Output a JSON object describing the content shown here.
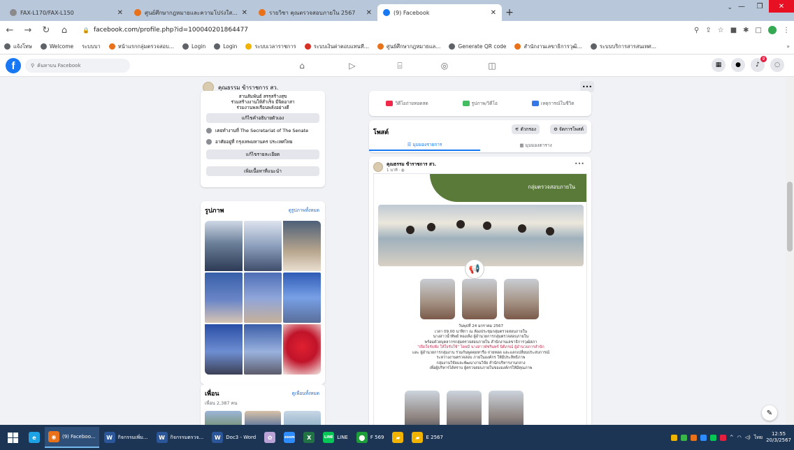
{
  "browser": {
    "tabs": [
      {
        "label": "FAX-L170/FAX-L150",
        "favicon": "gray"
      },
      {
        "label": "ศูนย์ศึกษากฎหมายและความโปร่งใส...",
        "favicon": "orange"
      },
      {
        "label": "รายวิชา คุณตรวจสอบภายใน 2567",
        "favicon": "orange"
      },
      {
        "label": "(9) Facebook",
        "favicon": "fb"
      }
    ],
    "new_tab": "+",
    "url": "facebook.com/profile.php?id=100040201864477",
    "bookmarks": [
      "แจ้งโทษ",
      "Welcome",
      "ระบบบา",
      "หน้าแรกกลุ่มตรวจสอบ...",
      "Login",
      "Login",
      "ระบบเวลาราชการ",
      "ระบบเงินค่าตอบแทนที...",
      "ศูนย์ศึกษากฎหมายแล...",
      "Generate QR code",
      "สำนักงานเลขาธิการวุฒิ...",
      "ระบบบริการสารสนเทศ..."
    ],
    "bookmarks_more": "»"
  },
  "fb": {
    "search_placeholder": "ค้นหาบน Facebook",
    "notification_count": "9"
  },
  "profile": {
    "name": "คุณธรรม ข้าราชการ สว.",
    "bio": [
      "สานสัมพันธ์ สรรสร้างสุข",
      "ร่วมสร้างงานให้สำเร็จ มีจิตอาสา",
      "ร่วมงานพลเรือนพลังอย่างดี"
    ],
    "edit_bio": "แก้ไขคำอธิบายตัวเอง",
    "work": "เคยทำงานที่ The Secretariat of The Senate",
    "lives": "อาศัยอยู่ที่ กรุงเทพมหานคร ประเทศไทย",
    "edit_details": "แก้ไขรายละเอียด",
    "add_featured": "เพิ่มเนื้อหาที่แนะนำ"
  },
  "photos": {
    "title": "รูปภาพ",
    "link": "ดูรูปภาพทั้งหมด"
  },
  "friends": {
    "title": "เพื่อน",
    "count": "เพื่อน 2,387 คน",
    "link": "ดูเพื่อนทั้งหมด"
  },
  "composer": {
    "live": "วิดีโอถ่ายทอดสด",
    "photo": "รูปภาพ/วิดีโอ",
    "event": "เหตุการณ์ในชีวิต"
  },
  "posts": {
    "title": "โพสต์",
    "filter": "ตัวกรอง",
    "manage": "จัดการโพสต์",
    "list_view": "มุมมองรายการ",
    "grid_view": "มุมมองตาราง"
  },
  "post": {
    "author": "คุณธรรม ข้าราชการ สว.",
    "time": "1 นาที",
    "banner": "กลุ่มตรวจสอบภายใน",
    "caption": [
      "วันพุธที่ 24 มกราคม 2567",
      "เวลา 09.00 นาฬิกา ณ ห้องประชุมกลุ่มตรวจสอบภายใน",
      "นางสาวน้ำทิพย์ ทองเพ็ง ผู้อำนวยการกลุ่มตรวจสอบภายใน",
      "พร้อมด้วยบุคลากรกลุ่มตรวจสอบภายใน สำนักงานเลขาธิการวุฒิสภา",
      "\"เปิดใจรับฟัง ให้ใจรับใช้\" โดยมี นางสาวพัชรินทร์ นิติภรณ์ ผู้อำนวยการสำนัก",
      "และ ผู้อำนวยการกลุ่มงาน ร่วมกันพูดคุยหารือ ถ่ายทอด และแลกเปลี่ยนประสบการณ์",
      "ระหว่างงานตรวจสอบ ภายในองค์กร ให้มีประสิทธิภาพ",
      "กลุ่มงานวิจัยและพัฒนางานวิจัย สำนักบริหารงานกลาง",
      "เพื่อผู้บริหารได้ทราบ ผู้ตรวจสอบภายในขององค์กรให้มีคุณภาพ"
    ]
  },
  "taskbar": {
    "items": [
      {
        "label": "(9) Faceboo...",
        "icon": "chrome",
        "color": "#e8711a",
        "active": true
      },
      {
        "label": "กิจกรรมเพิ่ม...",
        "icon": "word",
        "color": "#2b579a",
        "active": false
      },
      {
        "label": "กิจกรรมตรวจ...",
        "icon": "word",
        "color": "#2b579a",
        "active": false
      },
      {
        "label": "Doc3 - Word",
        "icon": "word",
        "color": "#2b579a",
        "active": false
      },
      {
        "label": "",
        "icon": "app",
        "color": "#b9a3d6",
        "active": false
      },
      {
        "label": "",
        "icon": "zoom",
        "color": "#2d8cff",
        "active": false
      },
      {
        "label": "",
        "icon": "excel",
        "color": "#217346",
        "active": false
      },
      {
        "label": "LINE",
        "icon": "line",
        "color": "#06c755",
        "active": false
      },
      {
        "label": "F 569",
        "icon": "green-app",
        "color": "#1e9e3a",
        "active": false
      },
      {
        "label": "",
        "icon": "folder",
        "color": "#f0b400",
        "active": false
      },
      {
        "label": "E 2567",
        "icon": "folder",
        "color": "#f0b400",
        "active": false
      }
    ],
    "time": "12:55",
    "date": "20/3/2567",
    "lang": "ไทย"
  },
  "colors": {
    "fb_blue": "#1877f2",
    "taskbar": "#1c3554",
    "banner_green": "#5a7a3a"
  }
}
